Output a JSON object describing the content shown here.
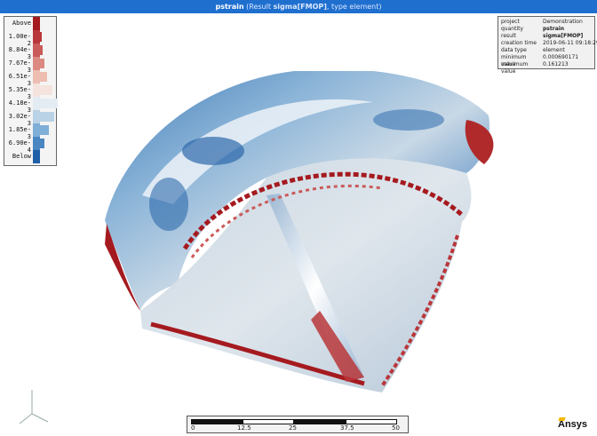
{
  "title": {
    "quantity": "pstrain",
    "result_prefix": "(Result ",
    "result_name": "sigma[FMOP]",
    "result_suffix": ", type element)"
  },
  "legend": {
    "items": [
      {
        "label": "Above",
        "color": "#a51a1f",
        "bar": 0
      },
      {
        "label": "1.00e-2",
        "color": "#b8373a",
        "bar": 2
      },
      {
        "label": "8.84e-3",
        "color": "#c95b5a",
        "bar": 3
      },
      {
        "label": "7.67e-3",
        "color": "#dc8a81",
        "bar": 5
      },
      {
        "label": "6.51e-3",
        "color": "#ecbdb0",
        "bar": 8
      },
      {
        "label": "5.35e-3",
        "color": "#f4e4dd",
        "bar": 14
      },
      {
        "label": "4.18e-3",
        "color": "#e4ecf3",
        "bar": 20
      },
      {
        "label": "3.02e-3",
        "color": "#b9d2e6",
        "bar": 16
      },
      {
        "label": "1.85e-3",
        "color": "#7faed6",
        "bar": 10
      },
      {
        "label": "6.90e-4",
        "color": "#4a87c2",
        "bar": 5
      },
      {
        "label": "Below",
        "color": "#1f5fa8",
        "bar": 0
      }
    ]
  },
  "info": {
    "rows": [
      {
        "key": "project",
        "value": "Demonstration",
        "bold": false
      },
      {
        "key": "quantity",
        "value": "pstrain",
        "bold": true
      },
      {
        "key": "result",
        "value": "sigma[FMOP]",
        "bold": true
      },
      {
        "key": "creation time",
        "value": "2019-06-11 09:18:29",
        "bold": false
      },
      {
        "key": "data type",
        "value": "element",
        "bold": false
      },
      {
        "key": "minimum value",
        "value": "0.000690171",
        "bold": false
      },
      {
        "key": "maximum value",
        "value": "0.161213",
        "bold": false
      }
    ]
  },
  "scale": {
    "ticks": [
      "0",
      "12.5",
      "25",
      "37.5",
      "50"
    ]
  },
  "logo": {
    "text": "Ansys"
  },
  "colors": {
    "titlebar": "#1f6fcf",
    "high": "#a51a1f",
    "low": "#1f5fa8",
    "mid": "#e8ecef"
  }
}
